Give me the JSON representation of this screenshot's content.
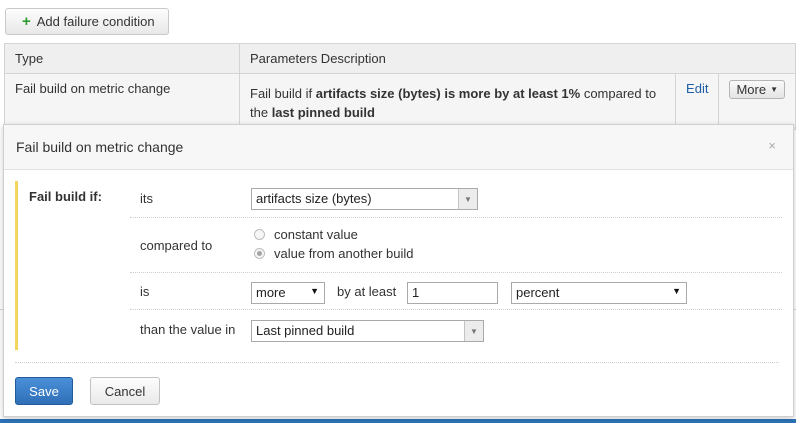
{
  "toolbar": {
    "add_label": "Add failure condition",
    "add_icon": "plus-icon"
  },
  "table": {
    "headers": [
      "Type",
      "Parameters Description"
    ],
    "row": {
      "type": "Fail build on metric change",
      "desc_prefix": "Fail build if ",
      "desc_bold1": "artifacts size (bytes) is more by at least 1%",
      "desc_mid": " compared to the ",
      "desc_bold2": "last pinned build",
      "edit_label": "Edit",
      "more_label": "More"
    }
  },
  "dialog": {
    "title": "Fail build on metric change",
    "close_glyph": "×",
    "section_label": "Fail build if:",
    "rows": {
      "its_label": "its",
      "metric_value": "artifacts size (bytes)",
      "compared_label": "compared to",
      "radio_constant": "constant value",
      "radio_another": "value from another build",
      "is_label": "is",
      "direction_value": "more",
      "by_at_least_label": "by at least",
      "threshold_value": "1",
      "unit_value": "percent",
      "than_label": "than the value in",
      "build_value": "Last pinned build"
    },
    "save_label": "Save",
    "cancel_label": "Cancel"
  },
  "colors": {
    "accent": "#2d73ba",
    "section_marker": "#f4d55e",
    "plus": "#2e9a2e"
  }
}
